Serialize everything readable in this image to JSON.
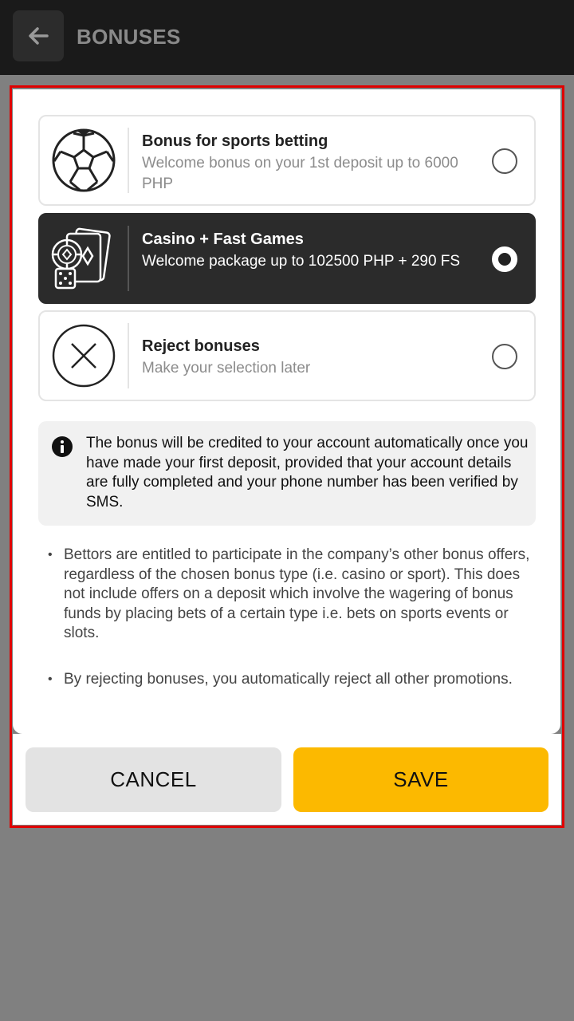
{
  "header": {
    "title": "BONUSES"
  },
  "options": [
    {
      "title": "Bonus for sports betting",
      "description": "Welcome bonus on your 1st deposit up to 6000 PHP",
      "icon": "soccer-ball-icon",
      "selected": false
    },
    {
      "title": "Casino + Fast Games",
      "description": "Welcome package up to 102500 PHP + 290 FS",
      "icon": "casino-chips-cards-dice-icon",
      "selected": true
    },
    {
      "title": "Reject bonuses",
      "description": "Make your selection later",
      "icon": "close-circle-icon",
      "selected": false
    }
  ],
  "info": {
    "text": "The bonus will be credited to your account automatically once you have made your first deposit, provided that your account details are fully completed and your phone number has been verified by SMS."
  },
  "bullets": [
    {
      "dot": "•",
      "text": "Bettors are entitled to participate in the company’s other bonus offers, regardless of the chosen bonus type (i.e. casino or sport). This does not include offers on a deposit which involve the wagering of bonus funds by placing bets of a certain type i.e. bets on sports events or slots."
    },
    {
      "dot": "•",
      "text": "By rejecting bonuses, you automatically reject all other promotions."
    }
  ],
  "buttons": {
    "cancel": "CANCEL",
    "save": "SAVE"
  },
  "colors": {
    "accent": "#fcb900",
    "selected_bg": "#2b2b2b",
    "highlight_frame": "#e00000"
  }
}
